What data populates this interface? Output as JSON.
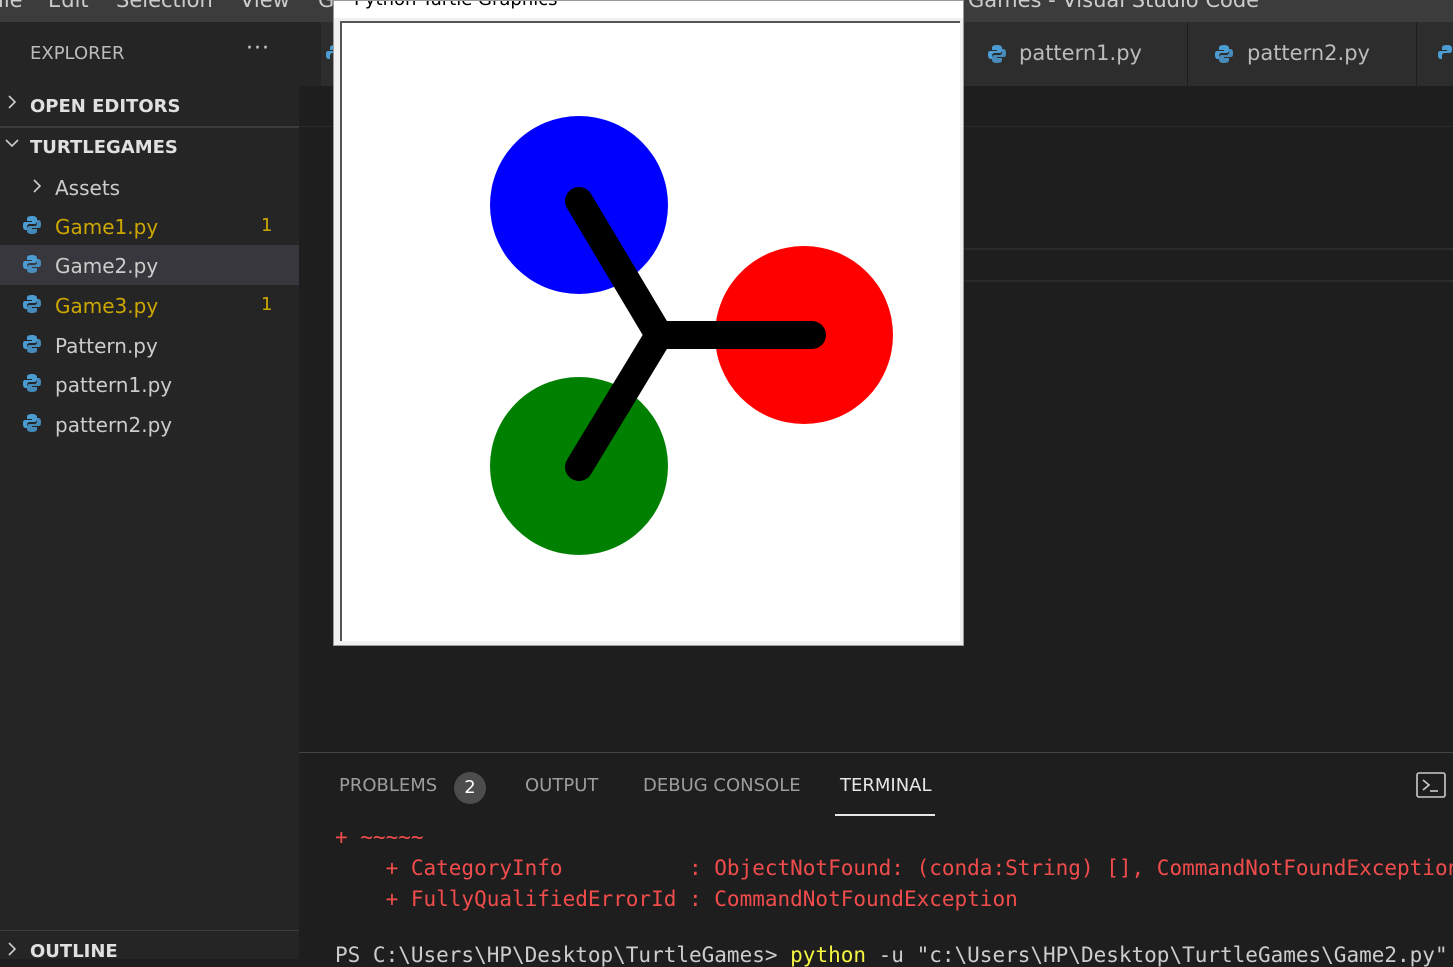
{
  "menubar": {
    "items": [
      "ile",
      "Edit",
      "Selection",
      "View",
      "G"
    ],
    "title": "Games - Visual Studio Code"
  },
  "sidebar": {
    "header": "EXPLORER",
    "more": "···",
    "open_editors": "OPEN EDITORS",
    "folder": "TURTLEGAMES",
    "items": [
      {
        "name": "Assets",
        "kind": "folder"
      },
      {
        "name": "Game1.py",
        "badge": "1"
      },
      {
        "name": "Game2.py"
      },
      {
        "name": "Game3.py",
        "badge": "1"
      },
      {
        "name": "Pattern.py"
      },
      {
        "name": "pattern1.py"
      },
      {
        "name": "pattern2.py"
      }
    ],
    "outline": "OUTLINE"
  },
  "tabs": [
    {
      "name": "pattern1.py"
    },
    {
      "name": "pattern2.py"
    }
  ],
  "turtle_window": {
    "title": "Python Turtle Graphics",
    "circles": [
      {
        "color": "#0000ff"
      },
      {
        "color": "#ff0000"
      },
      {
        "color": "#008000"
      }
    ],
    "line_color": "#000000"
  },
  "panel": {
    "tabs": [
      "PROBLEMS",
      "OUTPUT",
      "DEBUG CONSOLE",
      "TERMINAL"
    ],
    "problems_count": "2",
    "terminal_lines": [
      "+ ~~~~~",
      "    + CategoryInfo          : ObjectNotFound: (conda:String) [], CommandNotFoundException",
      "    + FullyQualifiedErrorId : CommandNotFoundException"
    ],
    "prompt_prefix": "PS C:\\Users\\HP\\Desktop\\TurtleGames> ",
    "prompt_cmd": "python",
    "prompt_rest": " -u \"c:\\Users\\HP\\Desktop\\TurtleGames\\Game2.py\""
  }
}
